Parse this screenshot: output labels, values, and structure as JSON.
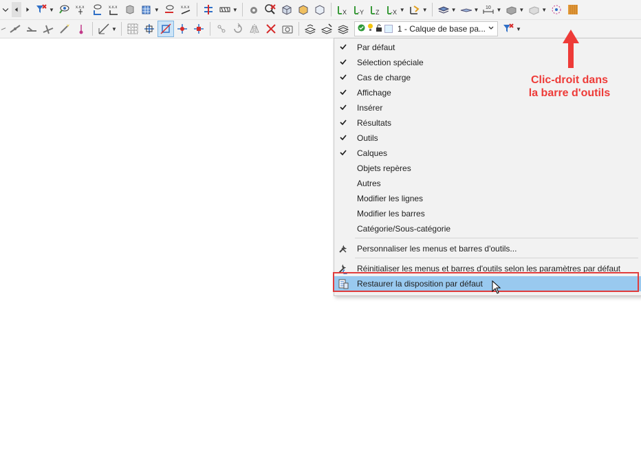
{
  "toolbar_row2": {
    "layer_combo_text": "1 - Calque de base pa..."
  },
  "context_menu": {
    "items": [
      {
        "label": "Par défaut",
        "checked": true
      },
      {
        "label": "Sélection spéciale",
        "checked": true
      },
      {
        "label": "Cas de charge",
        "checked": true
      },
      {
        "label": "Affichage",
        "checked": true
      },
      {
        "label": "Insérer",
        "checked": true
      },
      {
        "label": "Résultats",
        "checked": true
      },
      {
        "label": "Outils",
        "checked": true
      },
      {
        "label": "Calques",
        "checked": true
      },
      {
        "label": "Objets repères",
        "checked": false
      },
      {
        "label": "Autres",
        "checked": false
      },
      {
        "label": "Modifier les lignes",
        "checked": false
      },
      {
        "label": "Modifier les barres",
        "checked": false
      },
      {
        "label": "Catégorie/Sous-catégorie",
        "checked": false
      }
    ],
    "customize_label": "Personnaliser les menus et barres d'outils...",
    "reset_label": "Réinitialiser les menus et barres d'outils selon les paramètres par défaut",
    "restore_label": "Restaurer la disposition par défaut",
    "highlighted_item": "Restaurer la disposition par défaut"
  },
  "annotation": {
    "line1": "Clic-droit dans",
    "line2": "la barre d'outils",
    "color": "#ee3b38"
  },
  "colors": {
    "highlight": "#99c9ef",
    "red_box": "#e03c3c",
    "toolbar_bg": "#f3f3f3"
  },
  "icons": {
    "checkmark": "check-icon",
    "customize": "tools-icon",
    "reset": "reset-tools-icon",
    "restore": "restore-layout-icon"
  }
}
